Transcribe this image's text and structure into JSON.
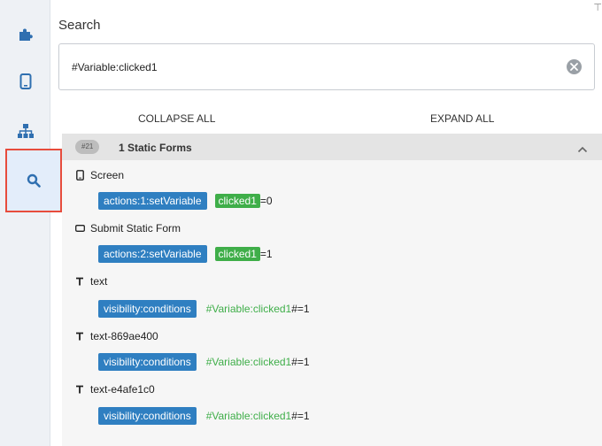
{
  "sidebar": {
    "items": [
      {
        "icon": "puzzle-icon"
      },
      {
        "icon": "mobile-icon"
      },
      {
        "icon": "sitemap-icon"
      },
      {
        "icon": "search-icon",
        "active": true
      }
    ],
    "accent": "#2f7fc1",
    "highlight": "#e74c3c"
  },
  "panel": {
    "title": "Search",
    "pin": "⊤"
  },
  "search": {
    "value": "#Variable:clicked1"
  },
  "controls": {
    "collapse_all": "COLLAPSE ALL",
    "expand_all": "EXPAND ALL"
  },
  "group": {
    "badge": "#21",
    "title": "1 Static Forms"
  },
  "results": [
    {
      "type_icon": "mobile-icon",
      "label": "Screen",
      "chip": "actions:1:setVariable",
      "hit": "clicked1",
      "rest": "=0"
    },
    {
      "type_icon": "rectangle-icon",
      "label": "Submit Static Form",
      "chip": "actions:2:setVariable",
      "hit": "clicked1",
      "rest": "=1"
    },
    {
      "type_icon": "text-icon",
      "label": "text",
      "chip": "visibility:conditions",
      "cond": "#Variable:clicked1",
      "rest": "#=1"
    },
    {
      "type_icon": "text-icon",
      "label": "text-869ae400",
      "chip": "visibility:conditions",
      "cond": "#Variable:clicked1",
      "rest": "#=1"
    },
    {
      "type_icon": "text-icon",
      "label": "text-e4afe1c0",
      "chip": "visibility:conditions",
      "cond": "#Variable:clicked1",
      "rest": "#=1"
    }
  ]
}
